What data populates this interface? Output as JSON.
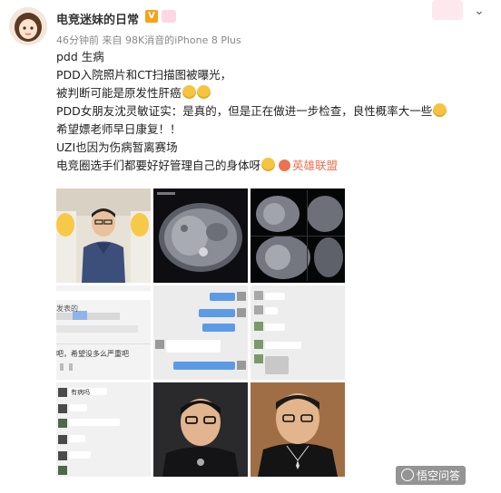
{
  "header": {
    "username": "电竞迷妹的日常",
    "verified_badge": "V",
    "meta": "46分钟前 来自 98K消音的iPhone 8 Plus"
  },
  "post": {
    "lines": [
      "pdd 生病",
      "PDD入院照片和CT扫描图被曝光，",
      "被判断可能是原发性肝癌",
      "PDD女朋友沈灵敏证实：是真的，但是正在做进一步检查，良性概率大一些",
      "希望嫖老师早日康复！！",
      "UZI也因为伤病暂离赛场",
      "电竞圈选手们都要好好管理自己的身体呀"
    ],
    "topic_link": "英雄联盟"
  },
  "images": {
    "chat1": {
      "text_a": "发表的",
      "text_b": "吧，希望没多么严重吧"
    },
    "chat4": {
      "text_a": "有病吗"
    }
  },
  "watermark": {
    "text": "悟空问答"
  },
  "colors": {
    "link": "#eb7350",
    "meta": "#888888",
    "badge": "#f7a21b"
  },
  "icons": [
    "chevron-down-icon",
    "verified-icon",
    "level-icon",
    "emoji-icon",
    "topic-icon",
    "watermark-icon"
  ]
}
